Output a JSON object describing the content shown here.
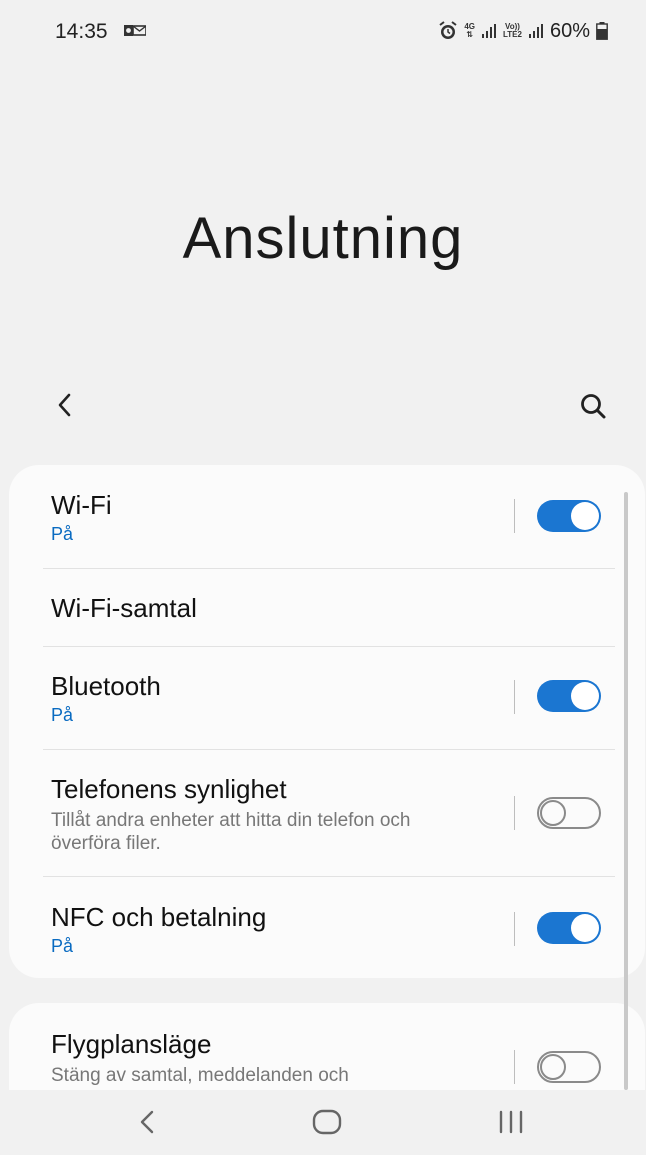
{
  "status_bar": {
    "time": "14:35",
    "notification_icon": "outlook-icon",
    "alarm_icon": "alarm-icon",
    "network_top": "4G",
    "volte_top": "Vo))",
    "volte_bottom": "LTE2",
    "battery_percent": "60%"
  },
  "header": {
    "title": "Anslutning",
    "back_icon": "back-arrow-icon",
    "search_icon": "search-icon"
  },
  "settings": {
    "wifi": {
      "title": "Wi-Fi",
      "status": "På",
      "enabled": true
    },
    "wifi_calling": {
      "title": "Wi-Fi-samtal"
    },
    "bluetooth": {
      "title": "Bluetooth",
      "status": "På",
      "enabled": true
    },
    "visibility": {
      "title": "Telefonens synlighet",
      "description": "Tillåt andra enheter att hitta din telefon och överföra filer.",
      "enabled": false
    },
    "nfc": {
      "title": "NFC och betalning",
      "status": "På",
      "enabled": true
    },
    "airplane": {
      "title": "Flygplansläge",
      "description": "Stäng av samtal, meddelanden och",
      "enabled": false
    }
  },
  "nav_bar": {
    "back": "nav-back-icon",
    "home": "nav-home-icon",
    "recents": "nav-recents-icon"
  },
  "colors": {
    "accent": "#1b76d1",
    "status_text": "#0a6bc1",
    "background": "#f1f1f1",
    "card": "#fbfbfb"
  }
}
